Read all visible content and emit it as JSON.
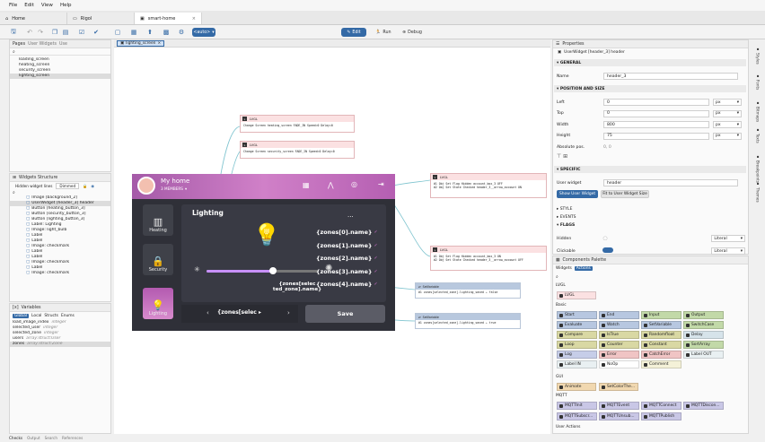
{
  "menu": [
    "File",
    "Edit",
    "View",
    "Help"
  ],
  "tabs": [
    {
      "label": "Home",
      "icon": "home-icon"
    },
    {
      "label": "Rigol",
      "icon": "device-icon"
    },
    {
      "label": "smart-home",
      "icon": "project-icon"
    }
  ],
  "toolbar": {
    "layout_select": "<auto>",
    "edit_label": "Edit",
    "run_label": "Run",
    "debug_label": "Debug"
  },
  "pages_panel": {
    "tabs": [
      "Pages",
      "User Widgets",
      "Use"
    ],
    "search_placeholder": "",
    "items": [
      "loading_screen",
      "heating_screen",
      "security_screen",
      "lighting_screen"
    ],
    "selected": 3
  },
  "editor_tab": "lighting_screen",
  "widgets_panel": {
    "title": "Widgets Structure",
    "filter_label": "Hidden widget lines",
    "filter_value": "Dimmed",
    "items": [
      "Image [background_2]",
      "UserWidget [header_3] header",
      "Button [heating_button_3]",
      "Button [security_button_3]",
      "Button [lighting_button_3]",
      "Label: Lighting",
      "Image: light_bulb",
      "Label",
      "Label",
      "Image: checkmark",
      "Label",
      "Label",
      "Image: checkmark",
      "Label",
      "Image: checkmark"
    ],
    "selected": 1
  },
  "variables_panel": {
    "title": "Variables",
    "tabs": [
      "Global",
      "Local",
      "Structs",
      "Enums"
    ],
    "items": [
      {
        "name": "load_image_index",
        "type": "integer"
      },
      {
        "name": "selected_user",
        "type": "integer"
      },
      {
        "name": "selected_zone",
        "type": "integer"
      },
      {
        "name": "users",
        "type": "array:struct:User"
      },
      {
        "name": "zones",
        "type": "array:struct:Zone"
      }
    ],
    "selected": 4
  },
  "bottom_tabs": [
    "Checks",
    "Output",
    "Search",
    "References"
  ],
  "flow_nodes": [
    {
      "title": "LVGL",
      "body": "Change Screen  heating_screen  FADE_IN  Speed=0  Delay=0"
    },
    {
      "title": "LVGL",
      "body": "Change Screen  security_screen  FADE_IN  Speed=0  Delay=0"
    },
    {
      "title": "LVGL",
      "body": "#1 Obj Set Flag Hidden  account_box_3  OFF\n#2 Obj Set State Checked  header_3__arrow_account  ON"
    },
    {
      "title": "LVGL",
      "body": "#1 Obj Set Flag Hidden  account_box_3  ON\n#2 Obj Set State Checked  header_3__arrow_account  OFF"
    },
    {
      "title": "SetVariable",
      "body": "#1  zones[selected_zone].lighting_saved  ←  false"
    },
    {
      "title": "SetVariable",
      "body": "#1  zones[selected_zone].lighting_saved  ←  true"
    }
  ],
  "device_ui": {
    "home_title": "My home",
    "members": "3 MEMBERS",
    "side_buttons": [
      "Heating",
      "Security",
      "Lighting"
    ],
    "section_title": "Lighting",
    "more": "...",
    "zone_names": [
      "{zones[0].name}",
      "{zones[1].name}",
      "{zones[2].name}",
      "{zones[3].name}",
      "{zones[4].name}"
    ],
    "selected_zone_text": "{zones[selected_zone].lighting_percent}",
    "zone_name_label": "{zones[selec ted_zone].name}",
    "save_label": "Save",
    "slider_value": 0.6
  },
  "properties": {
    "title": "Properties",
    "object": "UserWidget [header_3] header",
    "general_section": "GENERAL",
    "name_label": "Name",
    "name_value": "header_3",
    "pos_section": "POSITION AND SIZE",
    "fields": [
      {
        "label": "Left",
        "value": "0",
        "unit": "px"
      },
      {
        "label": "Top",
        "value": "0",
        "unit": "px"
      },
      {
        "label": "Width",
        "value": "800",
        "unit": "px"
      },
      {
        "label": "Height",
        "value": "75",
        "unit": "px"
      }
    ],
    "abs_pos_label": "Absolute pos.",
    "abs_pos_value": "0, 0",
    "specific_section": "SPECIFIC",
    "user_widget_label": "User widget",
    "user_widget_value": "header",
    "show_user_widget": "Show User Widget",
    "fit_size": "Fit to User Widget Size",
    "collapsed_sections": [
      "STYLE",
      "EVENTS",
      "FLAGS"
    ],
    "hidden_label": "Hidden",
    "hidden_mode": "Literal",
    "clickable_label": "Clickable",
    "clickable_mode": "Literal"
  },
  "palette": {
    "title": "Components Palette",
    "tabs": [
      "Widgets",
      "Actions"
    ],
    "group_lvgl": "LVGL",
    "lvgl_item": "LVGL",
    "group_basic": "Basic",
    "basic": [
      {
        "label": "Start",
        "color": "#b7c7e0"
      },
      {
        "label": "End",
        "color": "#b7c7e0"
      },
      {
        "label": "Input",
        "color": "#c2d9a8"
      },
      {
        "label": "Output",
        "color": "#c2d9a8"
      },
      {
        "label": "Evaluate",
        "color": "#b7c7e0"
      },
      {
        "label": "Watch",
        "color": "#b7c7e0"
      },
      {
        "label": "SetVariable",
        "color": "#b7c7e0"
      },
      {
        "label": "SwitchCase",
        "color": "#c2d9a8"
      },
      {
        "label": "Compare",
        "color": "#d9d8a3"
      },
      {
        "label": "IsTrue",
        "color": "#d9d8a3"
      },
      {
        "label": "Randomfloat",
        "color": "#d9d8a3"
      },
      {
        "label": "Delay",
        "color": "#d6e3ea"
      },
      {
        "label": "Loop",
        "color": "#d9d8a3"
      },
      {
        "label": "Counter",
        "color": "#d9d8a3"
      },
      {
        "label": "Constant",
        "color": "#d9d8a3"
      },
      {
        "label": "SortArray",
        "color": "#c2d9a8"
      },
      {
        "label": "Log",
        "color": "#c6cde8"
      },
      {
        "label": "Error",
        "color": "#f0c4c4"
      },
      {
        "label": "CatchError",
        "color": "#f0c4c4"
      },
      {
        "label": "Label OUT",
        "color": "#e9f0f2"
      },
      {
        "label": "Label IN",
        "color": "#e9f0f2"
      },
      {
        "label": "NoOp",
        "color": "#ffffff"
      },
      {
        "label": "Comment",
        "color": "#f4f1d8"
      }
    ],
    "group_gui": "GUI",
    "gui": [
      "Animate",
      "SetColorThe..."
    ],
    "group_mqtt": "MQTT",
    "mqtt": [
      "MQTTInit",
      "MQTTEvent",
      "MQTTConnect",
      "MQTTDiscon...",
      "MQTTSubscr...",
      "MQTTUnsub...",
      "MQTTPublish"
    ],
    "group_user": "User Actions"
  },
  "right_vtabs": [
    "Styles",
    "Fonts",
    "Bitmaps",
    "Texts",
    "Breakpoints",
    "Themes"
  ],
  "colors": {
    "accent": "#346aa6",
    "header_purple": "#c070c0",
    "lvgl_node": "#fbe1e2",
    "setvar_node": "#b8c8de"
  }
}
